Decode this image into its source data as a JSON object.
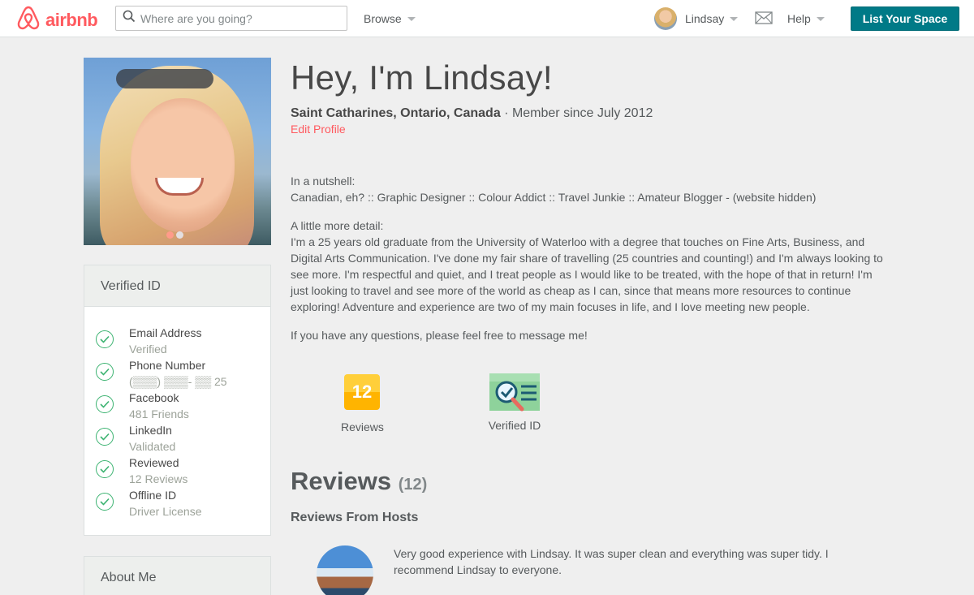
{
  "header": {
    "brand": "airbnb",
    "search_placeholder": "Where are you going?",
    "browse": "Browse",
    "user": "Lindsay",
    "help": "Help",
    "list_space": "List Your Space"
  },
  "profile": {
    "greeting": "Hey, I'm Lindsay!",
    "location": "Saint Catharines, Ontario, Canada",
    "member_since": " · Member since July 2012",
    "edit_profile": "Edit Profile",
    "nutshell_label": "In a nutshell:",
    "nutshell": "Canadian, eh? :: Graphic Designer :: Colour Addict :: Travel Junkie :: Amateur Blogger - (website hidden)",
    "detail_label": "A little more detail:",
    "detail": "I'm a 25 years old graduate from the University of Waterloo with a degree that touches on Fine Arts, Business, and Digital Arts Communication. I've done my fair share of travelling (25 countries and counting!) and I'm always looking to see more. I'm respectful and quiet, and I treat people as I would like to be treated, with the hope of that in return! I'm just looking to travel and see more of the world as cheap as I can, since that means more resources to continue exploring! Adventure and experience are two of my main focuses in life, and I love meeting new people.",
    "questions": "If you have any questions, please feel free to message me!"
  },
  "stats": {
    "reviews_count": "12",
    "reviews_label": "Reviews",
    "verified_label": "Verified ID"
  },
  "verified_panel": {
    "title": "Verified ID",
    "items": [
      {
        "title": "Email Address",
        "sub": "Verified"
      },
      {
        "title": "Phone Number",
        "sub": "(▒▒▒) ▒▒▒- ▒▒ 25"
      },
      {
        "title": "Facebook",
        "sub": "481 Friends"
      },
      {
        "title": "LinkedIn",
        "sub": "Validated"
      },
      {
        "title": "Reviewed",
        "sub": "12 Reviews"
      },
      {
        "title": "Offline ID",
        "sub": "Driver License"
      }
    ]
  },
  "about_panel": {
    "title": "About Me"
  },
  "reviews": {
    "heading": "Reviews",
    "count": "(12)",
    "from_hosts": "Reviews From Hosts",
    "first_review": "Very good experience with Lindsay. It was super clean and everything was super tidy. I recommend Lindsay to everyone."
  },
  "colors": {
    "brand": "#ff5a5f",
    "primary_button": "#007a87",
    "check": "#3cb371"
  }
}
